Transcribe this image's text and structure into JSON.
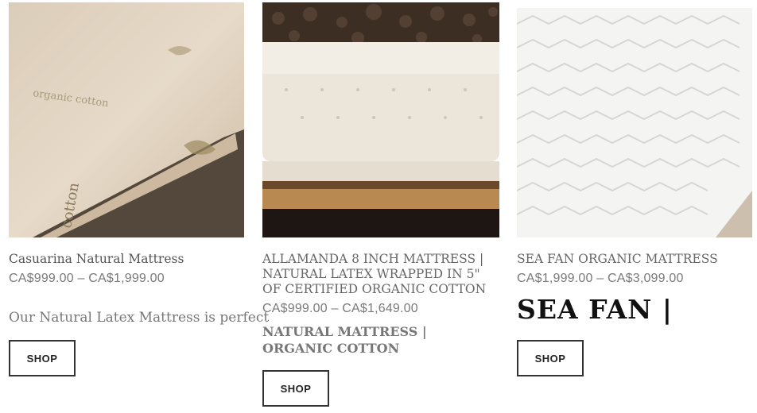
{
  "products": [
    {
      "title": "Casuarina Natural Mattress",
      "price": "CA$999.00 – CA$1,999.00",
      "description": "Our Natural Latex Mattress is perfect",
      "image_text": "organic cotton",
      "side_text": "cotton",
      "button": "SHOP"
    },
    {
      "title": "ALLAMANDA 8 INCH MATTRESS | NATURAL LATEX WRAPPED IN 5\" OF CERTIFIED ORGANIC COTTON",
      "price": "CA$999.00 – CA$1,649.00",
      "headline": "NATURAL MATTRESS | ORGANIC COTTON",
      "button": "SHOP"
    },
    {
      "title": "SEA FAN ORGANIC MATTRESS",
      "price": "CA$1,999.00 – CA$3,099.00",
      "headline": "SEA FAN |",
      "button": "SHOP"
    }
  ]
}
